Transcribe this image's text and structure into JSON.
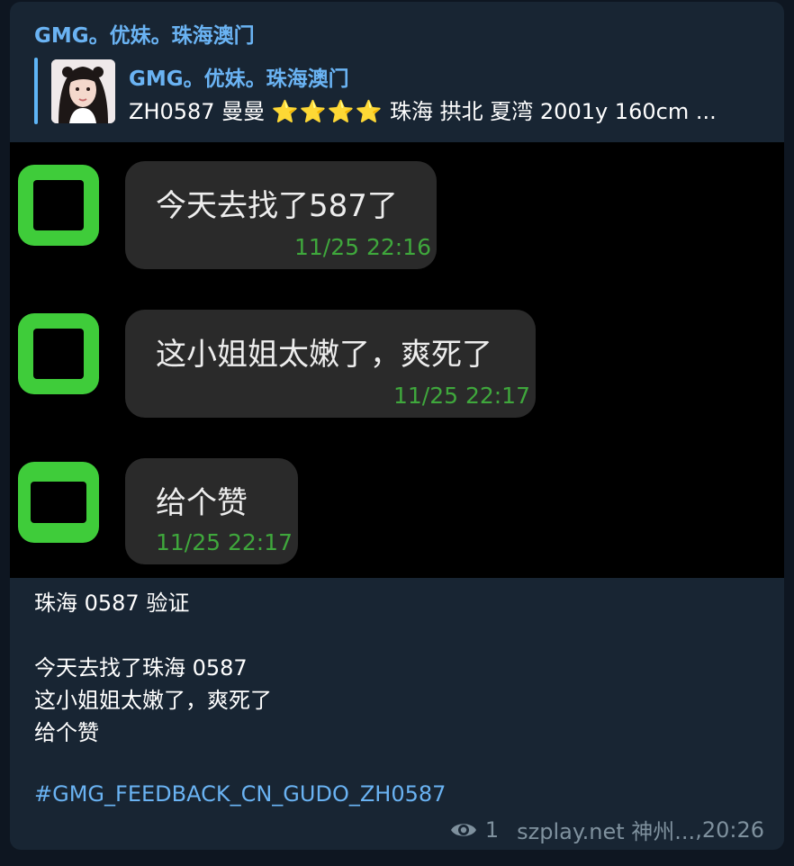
{
  "message": {
    "author": "GMG。优妹。珠海澳门",
    "reply": {
      "title": "GMG。优妹。珠海澳门",
      "text_prefix": "ZH0587 曼曼",
      "stars": "⭐⭐⭐⭐",
      "text_suffix": "珠海 拱北 夏湾 2001y  160cm ..."
    },
    "photo": {
      "chats": [
        {
          "text": "今天去找了587了",
          "time": "11/25 22:16"
        },
        {
          "text": "这小姐姐太嫩了，爽死了",
          "time": "11/25 22:17"
        },
        {
          "text": "给个赞",
          "time": "11/25 22:17"
        }
      ]
    },
    "caption": {
      "line1": "珠海 0587 验证",
      "line2": "",
      "line3": "今天去找了珠海 0587",
      "line4": "这小姐姐太嫩了，爽死了",
      "line5": "给个赞",
      "line6": ""
    },
    "hashtag": "#GMG_FEEDBACK_CN_GUDO_ZH0587",
    "views": "1",
    "signature": "szplay.net 神州...",
    "time": "20:26"
  },
  "colors": {
    "background": "#0e1621",
    "bubble": "#182533",
    "link": "#6ab3f3",
    "meta": "#7f919e",
    "chat_green": "#3fcc3a"
  }
}
